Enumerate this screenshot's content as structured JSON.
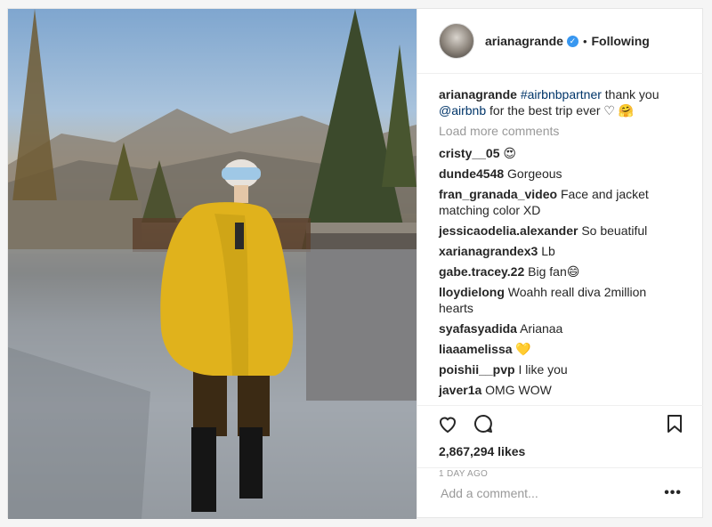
{
  "post": {
    "author": "arianagrande",
    "follow_status": "Following",
    "caption": {
      "user": "arianagrande",
      "hashtag": "#airbnbpartner",
      "text1": "thank you",
      "mention": "@airbnb",
      "text2": "for the best trip ever ♡ 🤗"
    },
    "load_more": "Load more comments",
    "comments": [
      {
        "user": "cristy__05",
        "text": "😍"
      },
      {
        "user": "dunde4548",
        "text": "Gorgeous"
      },
      {
        "user": "fran_granada_video",
        "text": "Face and jacket matching color XD"
      },
      {
        "user": "jessicaodelia.alexander",
        "text": "So beuatiful"
      },
      {
        "user": "xarianagrandex3",
        "text": "Lb"
      },
      {
        "user": "gabe.tracey.22",
        "text": "Big fan😄"
      },
      {
        "user": "lloydielong",
        "text": "Woahh reall diva 2million hearts"
      },
      {
        "user": "syafasyadida",
        "text": "Arianaa"
      },
      {
        "user": "liaaamelissa",
        "text": "💛"
      },
      {
        "user": "poishii__pvp",
        "text": "I like you"
      },
      {
        "user": "javer1a",
        "text": "OMG WOW"
      }
    ],
    "likes": "2,867,294 likes",
    "time": "1 DAY AGO",
    "add_comment_placeholder": "Add a comment...",
    "more_options": "•••"
  },
  "icons": {
    "like": "heart-icon",
    "comment": "comment-icon",
    "save": "bookmark-icon",
    "verified": "verified-badge-icon"
  },
  "colors": {
    "link": "#003569",
    "verified": "#3897f0",
    "muted": "#999999"
  }
}
